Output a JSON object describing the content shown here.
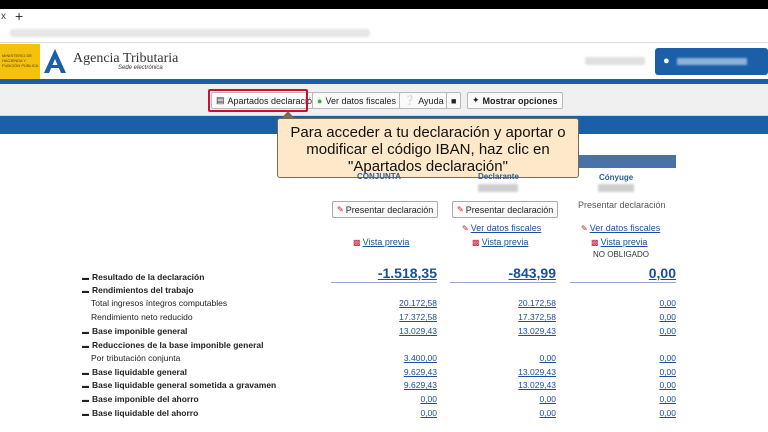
{
  "browser": {
    "tab_close": "x",
    "new_tab": "+"
  },
  "header": {
    "ministerio": "MINISTERIO DE HACIENDA Y FUNCIÓN PÚBLICA",
    "brand_title": "Agencia Tributaria",
    "brand_sub": "Sede electrónica",
    "user_icon": "user-icon"
  },
  "toolbar": {
    "apartados": "Apartados declaración",
    "ver_datos": "Ver datos fiscales",
    "ayuda": "Ayuda",
    "mostrar": "Mostrar opciones"
  },
  "callout": {
    "line1": "Para acceder a tu declaración y aportar o",
    "line2": "modificar el código IBAN, haz clic en",
    "line3": "\"Apartados declaración\""
  },
  "columns": [
    {
      "sub": "CONJUNTA",
      "action": "Presentar declaración",
      "link1": "",
      "link2": "Vista previa"
    },
    {
      "sub": "Declarante",
      "action": "Presentar declaración",
      "link1": "Ver datos fiscales",
      "link2": "Vista previa"
    },
    {
      "sub": "Cónyuge",
      "action": "Presentar declaración",
      "link1": "Ver datos fiscales",
      "link2": "Vista previa",
      "status": "NO OBLIGADO"
    }
  ],
  "rows": [
    {
      "label": "Resultado de la declaración",
      "bold": true,
      "values": [
        "-1.518,35",
        "-843,99",
        "0,00"
      ],
      "big": true
    },
    {
      "label": "Rendimientos del trabajo",
      "bold": true,
      "values": [
        "",
        "",
        ""
      ]
    },
    {
      "label": "Total ingresos íntegros computables",
      "bold": false,
      "values": [
        "20.172,58",
        "20.172,58",
        "0,00"
      ]
    },
    {
      "label": "Rendimiento neto reducido",
      "bold": false,
      "values": [
        "17.372,58",
        "17.372,58",
        "0,00"
      ]
    },
    {
      "label": "Base imponible general",
      "bold": true,
      "values": [
        "13.029,43",
        "13.029,43",
        "0,00"
      ]
    },
    {
      "label": "Reducciones de la base imponible general",
      "bold": true,
      "values": [
        "",
        "",
        ""
      ]
    },
    {
      "label": "Por tributación conjunta",
      "bold": false,
      "values": [
        "3.400,00",
        "0,00",
        "0,00"
      ]
    },
    {
      "label": "Base liquidable general",
      "bold": true,
      "values": [
        "9.629,43",
        "13.029,43",
        "0,00"
      ]
    },
    {
      "label": "Base liquidable general sometida a gravamen",
      "bold": true,
      "values": [
        "9.629,43",
        "13.029,43",
        "0,00"
      ]
    },
    {
      "label": "Base imponible del ahorro",
      "bold": true,
      "values": [
        "0,00",
        "0,00",
        "0,00"
      ]
    },
    {
      "label": "Base liquidable del ahorro",
      "bold": true,
      "values": [
        "0,00",
        "0,00",
        "0,00"
      ]
    }
  ]
}
